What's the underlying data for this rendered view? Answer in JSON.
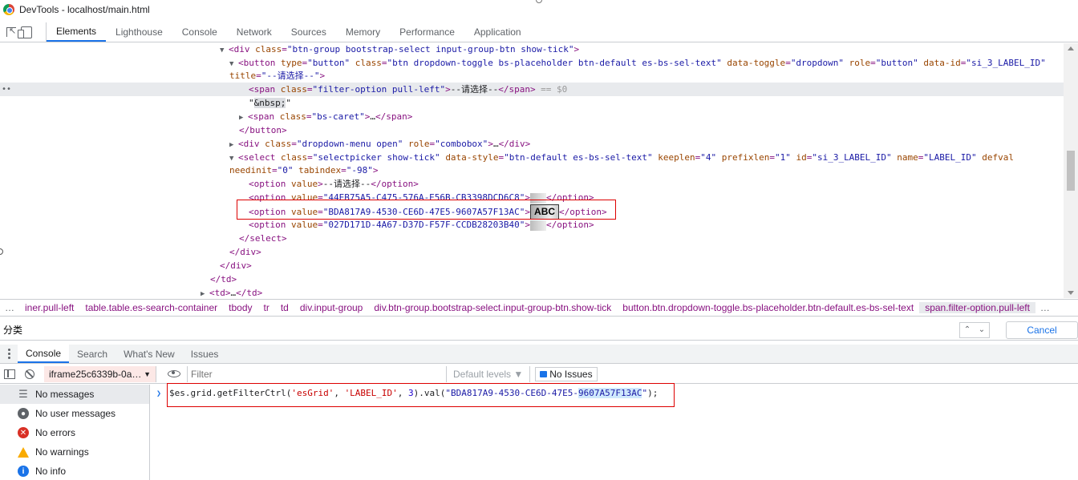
{
  "window": {
    "title": "DevTools - localhost/main.html"
  },
  "tabs": [
    "Elements",
    "Lighthouse",
    "Console",
    "Network",
    "Sources",
    "Memory",
    "Performance",
    "Application"
  ],
  "dom": {
    "l1": {
      "tag_open": "<div",
      "attr": "class",
      "val": "\"btn-group bootstrap-select input-group-btn show-tick\"",
      "close": ">"
    },
    "l2": {
      "tag_open": "<button",
      "a1": "type",
      "v1": "\"button\"",
      "a2": "class",
      "v2": "\"btn dropdown-toggle bs-placeholder btn-default es-bs-sel-text\"",
      "a3": "data-toggle",
      "v3": "\"dropdown\"",
      "a4": "role",
      "v4": "\"button\"",
      "a5": "data-id",
      "v5": "\"si_3_LABEL_ID\""
    },
    "l3": {
      "a": "title",
      "v": "\"--请选择--\"",
      "close": ">"
    },
    "l4": {
      "tag_open": "<span",
      "a": "class",
      "v": "\"filter-option pull-left\"",
      "text": "--请选择--",
      "tag_close": "</span>",
      "suffix": " == $0"
    },
    "l5": {
      "q1": "\"",
      "nbsp": "&nbsp;",
      "q2": "\""
    },
    "l6": {
      "tag_open": "<span",
      "a": "class",
      "v": "\"bs-caret\"",
      "text": "…",
      "tag_close": "</span>"
    },
    "l7": {
      "tag": "</button>"
    },
    "l8": {
      "tag_open": "<div",
      "a1": "class",
      "v1": "\"dropdown-menu open\"",
      "a2": "role",
      "v2": "\"combobox\"",
      "text": "…",
      "tag_close": "</div>"
    },
    "l9": {
      "tag_open": "<select",
      "a1": "class",
      "v1": "\"selectpicker show-tick\"",
      "a2": "data-style",
      "v2": "\"btn-default es-bs-sel-text\"",
      "a3": "keeplen",
      "v3": "\"4\"",
      "a4": "prefixlen",
      "v4": "\"1\"",
      "a5": "id",
      "v5": "\"si_3_LABEL_ID\"",
      "a6": "name",
      "v6": "\"LABEL_ID\"",
      "a7": "defval"
    },
    "l10": {
      "a1": "needinit",
      "v1": "\"0\"",
      "a2": "tabindex",
      "v2": "\"-98\"",
      "close": ">"
    },
    "l11": {
      "tag_open": "<option",
      "a": "value",
      "text": "--请选择--",
      "tag_close": "</option>"
    },
    "l12": {
      "tag_open": "<option",
      "a": "value",
      "v": "\"44EB75A5-C475-576A-E56B-CB3398DCD6C8\"",
      "tag_close": "</option>"
    },
    "l13": {
      "tag_open": "<option",
      "a": "value",
      "v": "\"BDA817A9-4530-CE6D-47E5-9607A57F13AC\"",
      "text": "ABC",
      "tag_close": "</option>"
    },
    "l14": {
      "tag_open": "<option",
      "a": "value",
      "v": "\"027D171D-4A67-D37D-F57F-CCDB28203B40\"",
      "tag_close": "</option>"
    },
    "l15": {
      "tag": "</select>"
    },
    "l16": {
      "tag": "</div>"
    },
    "l17": {
      "tag": "</div>"
    },
    "l18": {
      "tag": "</td>"
    },
    "l19": {
      "tag_open": "<td>",
      "text": "…",
      "tag_close": "</td>"
    }
  },
  "breadcrumbs": [
    "iner.pull-left",
    "table.table.es-search-container",
    "tbody",
    "tr",
    "td",
    "div.input-group",
    "div.btn-group.bootstrap-select.input-group-btn.show-tick",
    "button.btn.dropdown-toggle.bs-placeholder.btn-default.es-bs-sel-text",
    "span.filter-option.pull-left"
  ],
  "search": {
    "value": "分类",
    "cancel_label": "Cancel"
  },
  "drawer_tabs": [
    "Console",
    "Search",
    "What's New",
    "Issues"
  ],
  "console_toolbar": {
    "context": "iframe25c6339b-0a…",
    "filter_placeholder": "Filter",
    "levels": "Default levels ▼",
    "issues": "No Issues"
  },
  "console_sidebar": [
    "No messages",
    "No user messages",
    "No errors",
    "No warnings",
    "No info"
  ],
  "console_input": {
    "prefix": "$es.grid.getFilterCtrl(",
    "s1": "'esGrid'",
    "sep1": ", ",
    "s2": "'LABEL_ID'",
    "sep2": ", ",
    "n": "3",
    "mid": ").val(",
    "s3a": "\"BDA817A9-4530-CE6D-47E5-",
    "s3b": "9607A57F13AC",
    "s3c": "\"",
    "end": ");"
  }
}
